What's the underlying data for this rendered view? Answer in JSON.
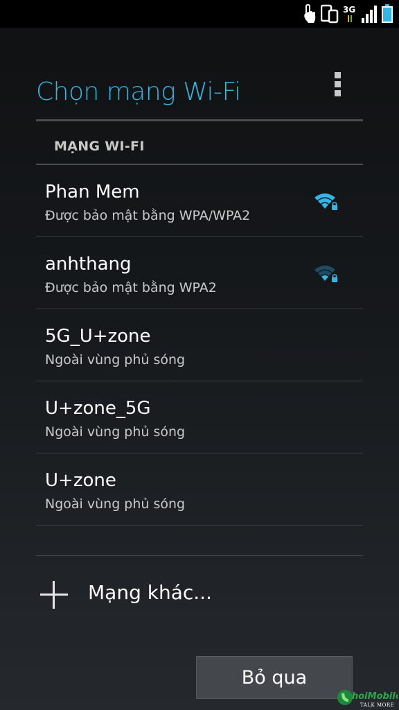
{
  "status_bar": {
    "icons": [
      "touch-hand-icon",
      "devices-icon",
      "network-3g-icon",
      "signal-icon",
      "battery-icon"
    ],
    "network_type": "3G"
  },
  "header": {
    "title": "Chọn mạng Wi-Fi",
    "accent_color": "#33b5e5"
  },
  "section": {
    "header": "MẠNG WI-FI"
  },
  "networks": [
    {
      "name": "Phan Mem",
      "status": "Được bảo mật bằng WPA/WPA2",
      "icon": "wifi-lock-icon",
      "signal": "strong"
    },
    {
      "name": "anhthang",
      "status": "Được bảo mật bằng WPA2",
      "icon": "wifi-lock-icon",
      "signal": "weak"
    },
    {
      "name": "5G_U+zone",
      "status": "Ngoài vùng phủ sóng"
    },
    {
      "name": "U+zone_5G",
      "status": "Ngoài vùng phủ sóng"
    },
    {
      "name": "U+zone",
      "status": "Ngoài vùng phủ sóng"
    }
  ],
  "add_network": {
    "label": "Mạng khác...",
    "icon": "plus-icon"
  },
  "buttons": {
    "skip": "Bỏ qua"
  },
  "watermark": {
    "brand": "hoiMobile",
    "tagline": "TALK MORE"
  }
}
